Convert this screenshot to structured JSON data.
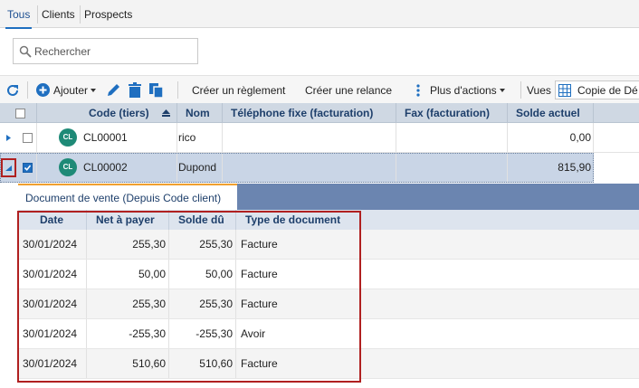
{
  "tabs": [
    {
      "label": "Tous",
      "active": true
    },
    {
      "label": "Clients",
      "active": false
    },
    {
      "label": "Prospects",
      "active": false
    }
  ],
  "search": {
    "placeholder": "Rechercher"
  },
  "toolbar": {
    "add_label": "Ajouter",
    "create_payment_label": "Créer un règlement",
    "create_reminder_label": "Créer une relance",
    "more_actions_label": "Plus d'actions",
    "views_label": "Vues",
    "view_copy_label": "Copie de Dé"
  },
  "grid": {
    "columns": {
      "code": "Code (tiers)",
      "name": "Nom",
      "phone": "Téléphone fixe (facturation)",
      "fax": "Fax (facturation)",
      "balance": "Solde actuel"
    },
    "rows": [
      {
        "avatar": "CL",
        "code": "CL00001",
        "name": "rico",
        "phone": "",
        "fax": "",
        "balance": "0,00",
        "checked": false
      },
      {
        "avatar": "CL",
        "code": "CL00002",
        "name": "Dupond",
        "phone": "",
        "fax": "",
        "balance": "815,90",
        "checked": true
      }
    ]
  },
  "detail": {
    "title": "Document de vente (Depuis Code client)",
    "columns": {
      "date": "Date",
      "net": "Net à payer",
      "due": "Solde dû",
      "type": "Type de document"
    },
    "rows": [
      {
        "date": "30/01/2024",
        "net": "255,30",
        "due": "255,30",
        "type": "Facture"
      },
      {
        "date": "30/01/2024",
        "net": "50,00",
        "due": "50,00",
        "type": "Facture"
      },
      {
        "date": "30/01/2024",
        "net": "255,30",
        "due": "255,30",
        "type": "Facture"
      },
      {
        "date": "30/01/2024",
        "net": "-255,30",
        "due": "-255,30",
        "type": "Avoir"
      },
      {
        "date": "30/01/2024",
        "net": "510,60",
        "due": "510,60",
        "type": "Facture"
      }
    ]
  },
  "colors": {
    "accent": "#1f6fc0",
    "header_text": "#1e3f6b",
    "highlight": "#b02020",
    "avatar": "#1e8a77"
  }
}
